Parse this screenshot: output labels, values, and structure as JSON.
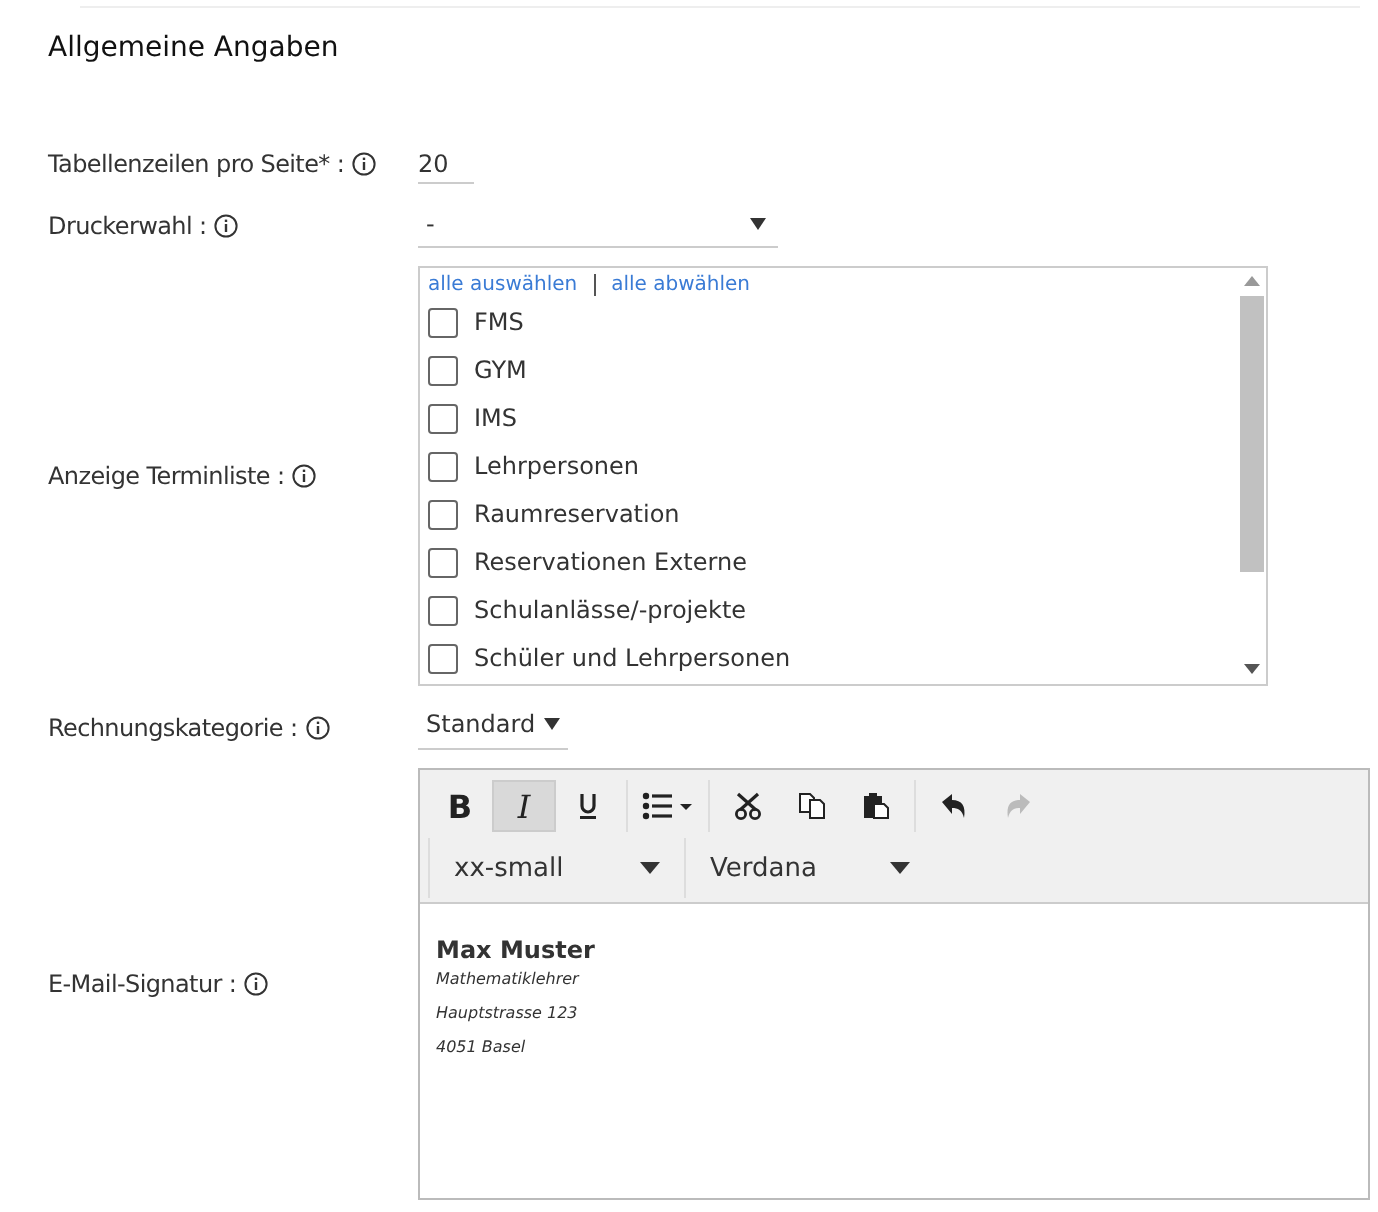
{
  "section": {
    "title": "Allgemeine Angaben"
  },
  "fields": [
    {
      "kind": "number",
      "label": "Tabellenzeilen pro Seite* :",
      "value": "20"
    },
    {
      "kind": "select",
      "label": "Druckerwahl :",
      "value": "-"
    },
    {
      "kind": "checklist",
      "label": "Anzeige Terminliste :",
      "links": [
        "alle auswählen",
        "alle abwählen"
      ],
      "options": [
        {
          "label": "FMS",
          "checked": false
        },
        {
          "label": "GYM",
          "checked": false
        },
        {
          "label": "IMS",
          "checked": false
        },
        {
          "label": "Lehrpersonen",
          "checked": false
        },
        {
          "label": "Raumreservation",
          "checked": false
        },
        {
          "label": "Reservationen Externe",
          "checked": false
        },
        {
          "label": "Schulanlässe/-projekte",
          "checked": false
        },
        {
          "label": "Schüler und Lehrpersonen",
          "checked": false
        }
      ]
    },
    {
      "kind": "inline-select",
      "label": "Rechnungskategorie :",
      "value": "Standard"
    },
    {
      "kind": "editor",
      "label": "E-Mail-Signatur :",
      "toolbar": [
        {
          "kind": "bold",
          "label": "B",
          "selected": false,
          "disabled": false
        },
        {
          "kind": "italic",
          "label": "I",
          "selected": true,
          "disabled": false
        },
        {
          "kind": "underline",
          "selected": false,
          "disabled": false
        },
        {
          "kind": "list",
          "selected": false,
          "disabled": false
        },
        {
          "kind": "cut",
          "selected": false,
          "disabled": false
        },
        {
          "kind": "copy",
          "selected": false,
          "disabled": false
        },
        {
          "kind": "paste",
          "selected": false,
          "disabled": false
        },
        {
          "kind": "undo",
          "selected": false,
          "disabled": false
        },
        {
          "kind": "redo",
          "selected": false,
          "disabled": true
        }
      ],
      "font_size": "xx-small",
      "font_name": "Verdana",
      "lines": [
        {
          "kind": "bold",
          "text": "Max Muster"
        },
        {
          "kind": "italic",
          "text": "Mathematiklehrer"
        },
        {
          "kind": "italic",
          "text": "Hauptstrasse 123"
        },
        {
          "kind": "italic",
          "text": "4051 Basel"
        }
      ]
    }
  ]
}
